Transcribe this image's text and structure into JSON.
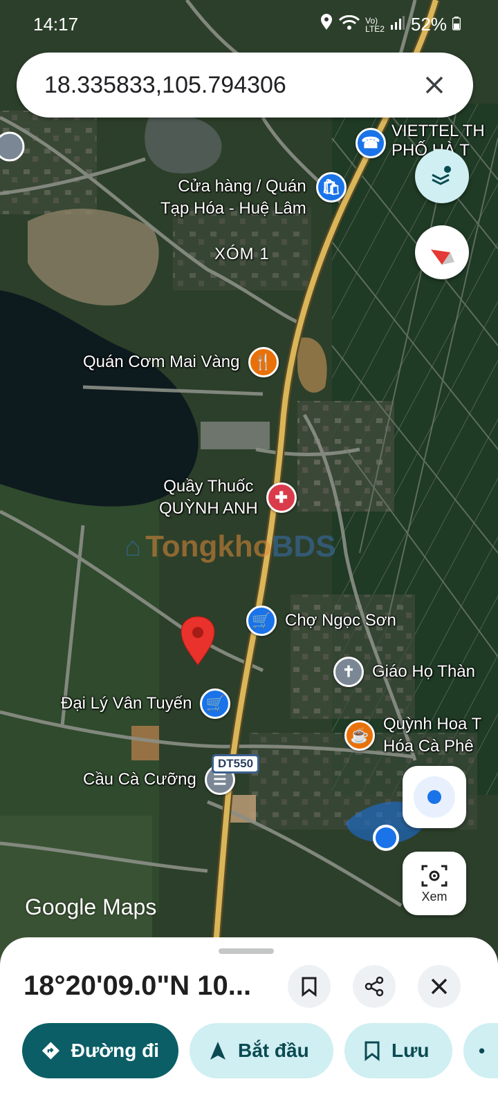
{
  "status_bar": {
    "time": "14:17",
    "battery": "52%",
    "network": "LTE2"
  },
  "search": {
    "query": "18.335833,105.794306"
  },
  "map": {
    "pois": [
      {
        "name": "VIETTEL TH\nPHỐ HÀ T",
        "type": "shopping",
        "color": "#1a73e8"
      },
      {
        "name": "Cửa hàng / Quán\nTạp Hóa - Huệ Lâm",
        "type": "shopping",
        "color": "#1a73e8"
      },
      {
        "name": "Quán Cơm Mai Vàng",
        "type": "restaurant",
        "color": "#e8710a"
      },
      {
        "name": "Quầy Thuốc\nQUỲNH ANH",
        "type": "pharmacy",
        "color": "#d93b4a"
      },
      {
        "name": "Chợ Ngọc Sơn",
        "type": "shopping",
        "color": "#1a73e8"
      },
      {
        "name": "Giáo Họ Thàn",
        "type": "church",
        "color": "#7b8794"
      },
      {
        "name": "Đại Lý Vân Tuyến",
        "type": "shopping",
        "color": "#1a73e8"
      },
      {
        "name": "Quỳnh Hoa T\nHóa Cà Phê",
        "type": "cafe",
        "color": "#e8710a"
      },
      {
        "name": "Cầu Cà Cưỡng",
        "type": "bridge",
        "color": "#7b8794"
      }
    ],
    "place_label": "XÓM 1",
    "road_shield": "DT550",
    "watermark": {
      "part1": "Tongkho",
      "part2": "BDS"
    },
    "attribution": "Google Maps"
  },
  "controls": {
    "street_view_label": "Xem"
  },
  "sheet": {
    "title": "18°20'09.0\"N 10...",
    "actions": {
      "directions": "Đường đi",
      "start": "Bắt đầu",
      "save": "Lưu"
    }
  },
  "colors": {
    "accent": "#0b5e66",
    "chip": "#cfeff2",
    "road": "#d9b65a",
    "location_blue": "#1a73e8"
  }
}
